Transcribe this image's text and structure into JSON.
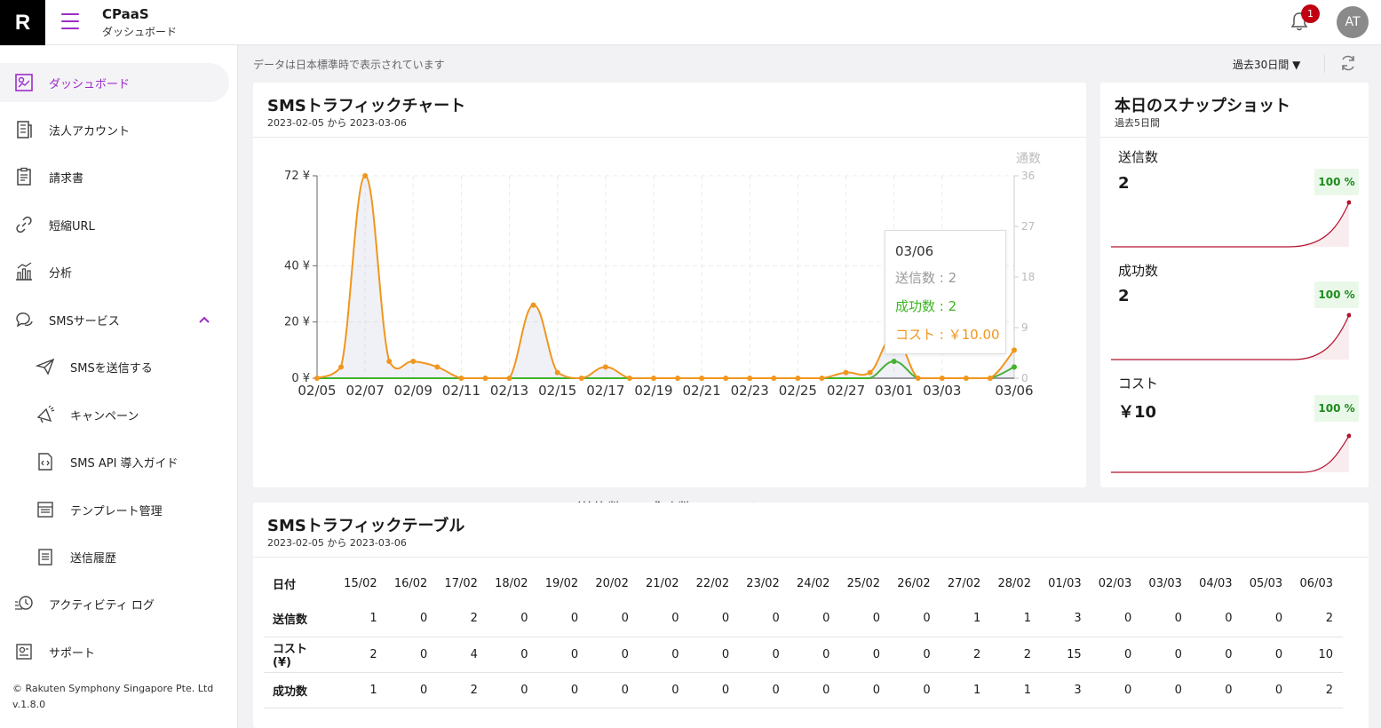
{
  "header": {
    "logo": "R",
    "title": "CPaaS",
    "subtitle": "ダッシュボード",
    "notification_count": "1",
    "avatar_initials": "AT"
  },
  "sidebar": {
    "items": [
      {
        "label": "ダッシュボード",
        "icon": "dashboard-icon",
        "active": true
      },
      {
        "label": "法人アカウント",
        "icon": "building-icon"
      },
      {
        "label": "請求書",
        "icon": "invoice-icon"
      },
      {
        "label": "短縮URL",
        "icon": "link-icon"
      },
      {
        "label": "分析",
        "icon": "analytics-icon"
      },
      {
        "label": "SMSサービス",
        "icon": "chat-icon",
        "expanded": true
      },
      {
        "label": "SMSを送信する",
        "icon": "send-icon",
        "sub": true
      },
      {
        "label": "キャンペーン",
        "icon": "megaphone-icon",
        "sub": true
      },
      {
        "label": "SMS API 導入ガイド",
        "icon": "code-doc-icon",
        "sub": true
      },
      {
        "label": "テンプレート管理",
        "icon": "template-icon",
        "sub": true
      },
      {
        "label": "送信履歴",
        "icon": "history-doc-icon",
        "sub": true
      },
      {
        "label": "アクティビティ ログ",
        "icon": "activity-log-icon"
      },
      {
        "label": "サポート",
        "icon": "support-icon"
      }
    ],
    "copyright": "© Rakuten Symphony Singapore Pte. Ltd",
    "version": "v.1.8.0"
  },
  "info": {
    "timezone_note": "データは日本標準時で表示されています",
    "period": "過去30日間 ▼"
  },
  "chart_card": {
    "title": "SMSトラフィックチャート",
    "range": "2023-02-05 から 2023-03-06"
  },
  "chart_data": {
    "type": "line",
    "x": [
      "02/05",
      "02/06",
      "02/07",
      "02/08",
      "02/09",
      "02/10",
      "02/11",
      "02/12",
      "02/13",
      "02/14",
      "02/15",
      "02/16",
      "02/17",
      "02/18",
      "02/19",
      "02/20",
      "02/21",
      "02/22",
      "02/23",
      "02/24",
      "02/25",
      "02/26",
      "02/27",
      "02/28",
      "03/01",
      "03/02",
      "03/03",
      "03/04",
      "03/05",
      "03/06"
    ],
    "x_tick_labels": [
      "02/05",
      "02/07",
      "02/09",
      "02/11",
      "02/13",
      "02/15",
      "02/17",
      "02/19",
      "02/21",
      "02/23",
      "02/25",
      "02/27",
      "03/01",
      "03/03",
      "03/06"
    ],
    "left_axis": {
      "ticks": [
        0,
        20,
        40,
        72
      ],
      "tick_labels": [
        "0 ¥",
        "20 ¥",
        "40 ¥",
        "72 ¥"
      ],
      "ylim": [
        0,
        72
      ]
    },
    "right_axis": {
      "label": "通数",
      "ticks": [
        0,
        9,
        18,
        27,
        36
      ],
      "ylim": [
        0,
        36
      ]
    },
    "series": [
      {
        "name": "送信数",
        "color": "#999999",
        "axis": "right",
        "values": [
          0,
          0,
          0,
          0,
          0,
          0,
          0,
          0,
          0,
          0,
          0,
          0,
          0,
          0,
          0,
          0,
          0,
          0,
          0,
          0,
          0,
          0,
          0,
          0,
          0,
          0,
          0,
          0,
          0,
          0
        ]
      },
      {
        "name": "成功数",
        "color": "#3cb521",
        "axis": "right",
        "values": [
          0,
          0,
          0,
          0,
          0,
          0,
          0,
          0,
          0,
          0,
          0,
          0,
          0,
          0,
          0,
          0,
          0,
          0,
          0,
          0,
          0,
          0,
          0,
          0,
          3,
          0,
          0,
          0,
          0,
          2
        ]
      },
      {
        "name": "コスト",
        "color": "#f0961e",
        "axis": "left",
        "values": [
          0,
          4,
          72,
          6,
          6,
          4,
          0,
          0,
          0,
          26,
          2,
          0,
          4,
          0,
          0,
          0,
          0,
          0,
          0,
          0,
          0,
          0,
          2,
          2,
          15,
          0,
          0,
          0,
          0,
          10
        ]
      }
    ],
    "grid": true,
    "legend": "bottom"
  },
  "tooltip": {
    "date": "03/06",
    "sent": "送信数 : 2",
    "success": "成功数 : 2",
    "cost": "コスト : ￥10.00"
  },
  "snapshot": {
    "title": "本日のスナップショット",
    "subtitle": "過去5日間",
    "items": [
      {
        "label": "送信数",
        "value": "2",
        "badge": "100 %"
      },
      {
        "label": "成功数",
        "value": "2",
        "badge": "100 %"
      },
      {
        "label": "コスト",
        "value": "￥10",
        "badge": "100 %"
      }
    ]
  },
  "table": {
    "title": "SMSトラフィックテーブル",
    "range": "2023-02-05 から 2023-03-06",
    "header_label": "日付",
    "dates": [
      "15/02",
      "16/02",
      "17/02",
      "18/02",
      "19/02",
      "20/02",
      "21/02",
      "22/02",
      "23/02",
      "24/02",
      "25/02",
      "26/02",
      "27/02",
      "28/02",
      "01/03",
      "02/03",
      "03/03",
      "04/03",
      "05/03",
      "06/03"
    ],
    "rows": [
      {
        "label": "送信数",
        "values": [
          "1",
          "0",
          "2",
          "0",
          "0",
          "0",
          "0",
          "0",
          "0",
          "0",
          "0",
          "0",
          "1",
          "1",
          "3",
          "0",
          "0",
          "0",
          "0",
          "2"
        ]
      },
      {
        "label": "コスト (¥)",
        "values": [
          "2",
          "0",
          "4",
          "0",
          "0",
          "0",
          "0",
          "0",
          "0",
          "0",
          "0",
          "0",
          "2",
          "2",
          "15",
          "0",
          "0",
          "0",
          "0",
          "10"
        ]
      },
      {
        "label": "成功数",
        "values": [
          "1",
          "0",
          "2",
          "0",
          "0",
          "0",
          "0",
          "0",
          "0",
          "0",
          "0",
          "0",
          "1",
          "1",
          "3",
          "0",
          "0",
          "0",
          "0",
          "2"
        ]
      }
    ]
  },
  "colors": {
    "accent": "#9b2cc9",
    "cost": "#f0961e",
    "success": "#3cb521",
    "sent": "#999999",
    "spark": "#b3122e"
  }
}
